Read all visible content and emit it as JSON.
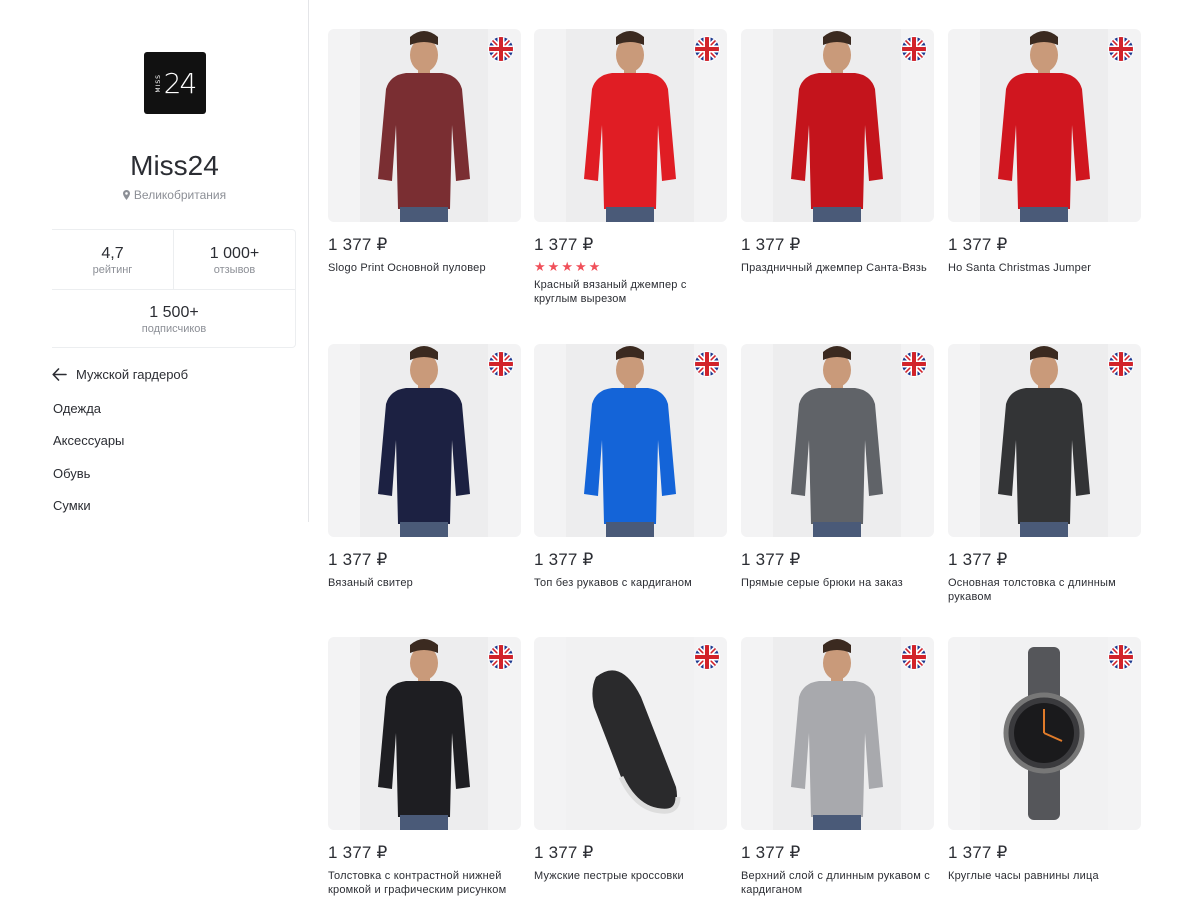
{
  "shop": {
    "logo_text": "24",
    "logo_vertical": "MISS",
    "name": "Miss24",
    "country": "Великобритания",
    "rating_value": "4,7",
    "rating_label": "рейтинг",
    "reviews_value": "1 000+",
    "reviews_label": "отзывов",
    "subscribers_value": "1 500+",
    "subscribers_label": "подписчиков"
  },
  "categories": {
    "back_label": "Мужской гардероб",
    "items": [
      "Одежда",
      "Аксессуары",
      "Обувь",
      "Сумки"
    ]
  },
  "products": [
    {
      "price": "1 377 ₽",
      "name": "Slogo Print Основной пуловер",
      "color": "#7a2e32"
    },
    {
      "price": "1 377 ₽",
      "name": "Красный вязаный джемпер с круглым вырезом",
      "color": "#e01d24",
      "stars": [
        "★",
        "★",
        "★",
        "★",
        "★"
      ]
    },
    {
      "price": "1 377 ₽",
      "name": "Праздничный джемпер Санта-Вязь",
      "color": "#c4141c"
    },
    {
      "price": "1 377 ₽",
      "name": "Ho Santa Christmas Jumper",
      "color": "#d0161f"
    },
    {
      "price": "1 377 ₽",
      "name": "Вязаный свитер",
      "color": "#1c2142"
    },
    {
      "price": "1 377 ₽",
      "name": "Топ без рукавов с кардиганом",
      "color": "#1464d8"
    },
    {
      "price": "1 377 ₽",
      "name": "Прямые серые брюки на заказ",
      "color": "#606368"
    },
    {
      "price": "1 377 ₽",
      "name": "Основная толстовка с длинным рукавом",
      "color": "#333436"
    },
    {
      "price": "1 377 ₽",
      "name": "Толстовка с контрастной нижней кромкой и графическим рисунком",
      "color": "#1e1e22"
    },
    {
      "price": "1 377 ₽",
      "name": "Мужские пестрые кроссовки",
      "color": "#2a2a2c"
    },
    {
      "price": "1 377 ₽",
      "name": "Верхний слой с длинным рукавом с кардиганом",
      "color": "#a8a9ad"
    },
    {
      "price": "1 377 ₽",
      "name": "Круглые часы равнины лица",
      "color": "#3a3a3d"
    }
  ],
  "icons": {
    "flag": "uk-flag-icon",
    "back": "arrow-left-icon",
    "location": "map-pin-icon"
  }
}
